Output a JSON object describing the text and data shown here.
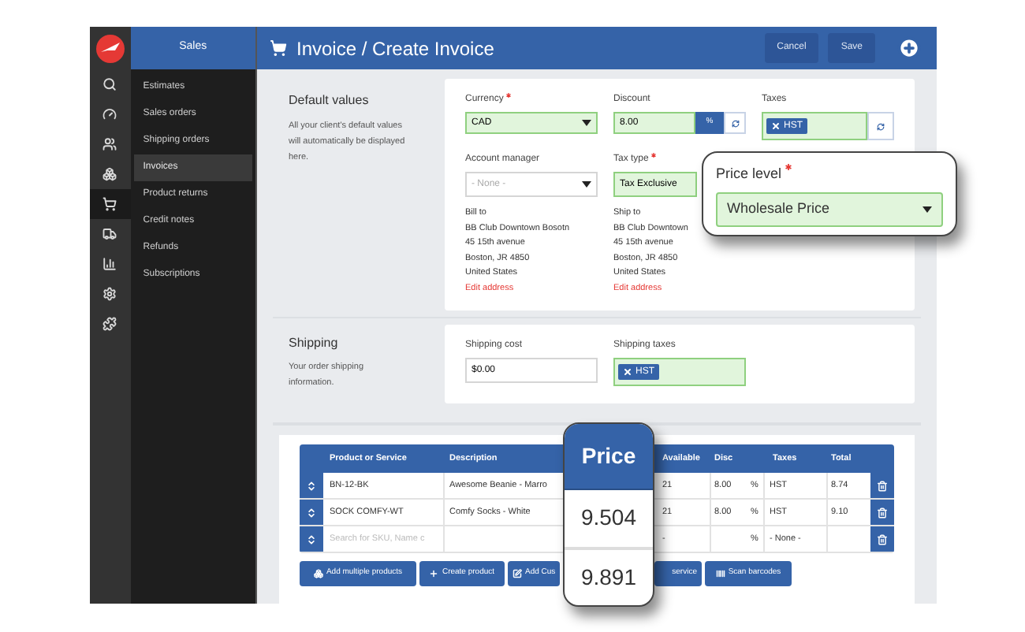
{
  "brand": {
    "section": "Sales"
  },
  "rail": [
    {
      "selected": false
    },
    {
      "selected": false
    },
    {
      "selected": false
    },
    {
      "selected": false
    },
    {
      "selected": true
    },
    {
      "selected": false
    },
    {
      "selected": false
    },
    {
      "selected": false
    },
    {
      "selected": false
    }
  ],
  "sidebar": {
    "items": [
      {
        "label": "Estimates",
        "selected": false
      },
      {
        "label": "Sales orders",
        "selected": false
      },
      {
        "label": "Shipping orders",
        "selected": false
      },
      {
        "label": "Invoices",
        "selected": true
      },
      {
        "label": "Product returns",
        "selected": false
      },
      {
        "label": "Credit notes",
        "selected": false
      },
      {
        "label": "Refunds",
        "selected": false
      },
      {
        "label": "Subscriptions",
        "selected": false
      }
    ]
  },
  "header": {
    "title": "Invoice / Create Invoice",
    "buttons": [
      "Cancel",
      "Save"
    ]
  },
  "default_values": {
    "title": "Default values",
    "description": "All your client's default values will automatically be displayed here.",
    "currency": {
      "label": "Currency",
      "required": true,
      "value": "CAD",
      "valid": true
    },
    "discount": {
      "label": "Discount",
      "required": false,
      "value": "8.00",
      "addon": "%",
      "valid": true
    },
    "taxes": {
      "label": "Taxes",
      "required": false,
      "tags": [
        "HST"
      ],
      "valid": true
    },
    "account_manager": {
      "label": "Account manager",
      "required": false,
      "placeholder": "- None -",
      "valid": false
    },
    "tax_type": {
      "label": "Tax type",
      "required": true,
      "value": "Tax Exclusive",
      "valid": true
    },
    "bill_to": {
      "label": "Bill to",
      "lines": [
        "BB Club Downtown Bosotn",
        "45 15th avenue",
        "Boston, JR 4850",
        "United States"
      ],
      "link": "Edit address"
    },
    "ship_to": {
      "label": "Ship to",
      "lines": [
        "BB Club Downtown",
        "45 15th avenue",
        "Boston, JR 4850",
        "United States"
      ],
      "link": "Edit address"
    }
  },
  "price_level": {
    "label": "Price level",
    "required": true,
    "value": "Wholesale Price",
    "valid": true
  },
  "shipping": {
    "title": "Shipping",
    "description": "Your order shipping information.",
    "cost": {
      "label": "Shipping cost",
      "required": false,
      "value": "$0.00",
      "valid": false
    },
    "taxes": {
      "label": "Shipping taxes",
      "required": false,
      "tags": [
        "HST"
      ],
      "valid": true
    }
  },
  "table": {
    "columns": [
      "Product or Service",
      "Description",
      "Available",
      "Disc",
      "Taxes",
      "Total"
    ],
    "rows": [
      {
        "product": "BN-12-BK",
        "description": "Awesome Beanie - Marro",
        "available": "21",
        "disc": "8.00",
        "unit": "%",
        "taxes": "HST",
        "total": "8.74"
      },
      {
        "product": "SOCK COMFY-WT",
        "description": "Comfy Socks - White",
        "available": "21",
        "disc": "8.00",
        "unit": "%",
        "taxes": "HST",
        "total": "9.10"
      },
      {
        "placeholder": "Search for SKU, Name c",
        "available": "-",
        "unit": "%",
        "taxes": "- None -"
      }
    ]
  },
  "actions": [
    "Add multiple products",
    "Create product",
    "Add Cus",
    "service",
    "Scan barcodes"
  ],
  "price_callout": {
    "title": "Price",
    "values": [
      "9.504",
      "9.891"
    ]
  }
}
